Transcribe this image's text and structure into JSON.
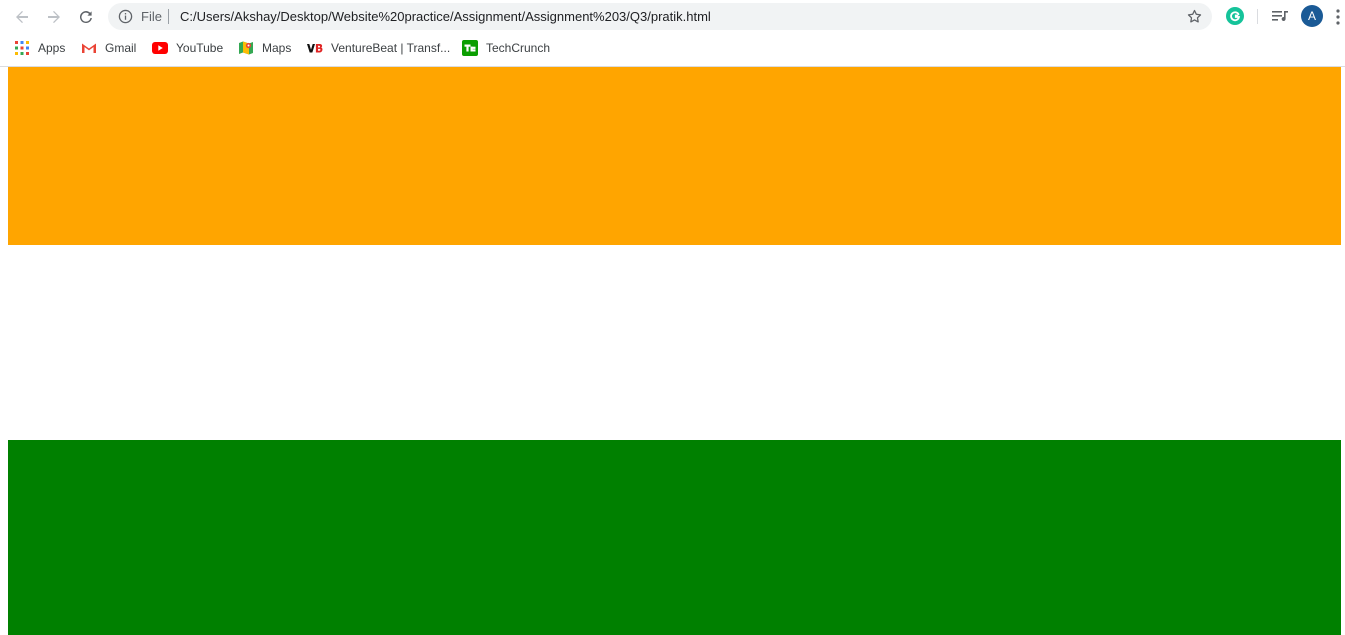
{
  "browser": {
    "scheme_label": "File",
    "url": "C:/Users/Akshay/Desktop/Website%20practice/Assignment/Assignment%203/Q3/pratik.html",
    "avatar_initial": "A",
    "bookmarks": [
      {
        "label": "Apps",
        "icon": "apps-grid-icon"
      },
      {
        "label": "Gmail",
        "icon": "gmail-icon"
      },
      {
        "label": "YouTube",
        "icon": "youtube-icon"
      },
      {
        "label": "Maps",
        "icon": "maps-icon"
      },
      {
        "label": "VentureBeat | Transf...",
        "icon": "venturebeat-icon"
      },
      {
        "label": "TechCrunch",
        "icon": "techcrunch-icon"
      }
    ]
  },
  "page": {
    "stripes": [
      {
        "name": "top",
        "color": "#FFA500"
      },
      {
        "name": "middle",
        "color": "#FFFFFF"
      },
      {
        "name": "bottom",
        "color": "#008000"
      }
    ]
  }
}
